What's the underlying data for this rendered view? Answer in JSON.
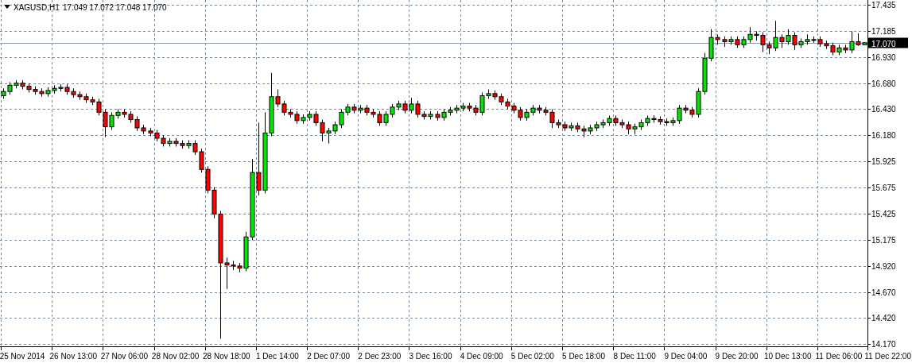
{
  "header": {
    "symbol": "XAGUSD,H1",
    "quote": "17.049 17.072 17.048 17.070"
  },
  "chart": {
    "axis_end_label": "11 Dec 22:00",
    "chart_data": {
      "type": "candlestick",
      "grid": true,
      "ylim": [
        14.17,
        17.435
      ],
      "yticks": [
        {
          "value": 17.435,
          "label": "17.435"
        },
        {
          "value": 17.185,
          "label": "17.185"
        },
        {
          "value": 16.93,
          "label": "16.930"
        },
        {
          "value": 16.68,
          "label": "16.680"
        },
        {
          "value": 16.43,
          "label": "16.430"
        },
        {
          "value": 16.18,
          "label": "16.180"
        },
        {
          "value": 15.925,
          "label": "15.925"
        },
        {
          "value": 15.675,
          "label": "15.675"
        },
        {
          "value": 15.425,
          "label": "15.425"
        },
        {
          "value": 15.175,
          "label": "15.175"
        },
        {
          "value": 14.92,
          "label": "14.920"
        },
        {
          "value": 14.67,
          "label": "14.670"
        },
        {
          "value": 14.42,
          "label": "14.420"
        },
        {
          "value": 14.17,
          "label": "14.170"
        }
      ],
      "ref_lines": [
        {
          "axis": "y",
          "value": 17.07,
          "label": "17.070"
        }
      ],
      "categories": [
        null,
        null,
        null,
        "25 Nov 2014",
        null,
        null,
        null,
        null,
        null,
        null,
        null,
        "26 Nov 13:00",
        null,
        null,
        null,
        null,
        null,
        null,
        null,
        "27 Nov 06:00",
        null,
        null,
        null,
        null,
        null,
        null,
        null,
        "28 Nov 02:00",
        null,
        null,
        null,
        null,
        null,
        null,
        null,
        "28 Nov 18:00",
        null,
        null,
        null,
        null,
        null,
        null,
        null,
        "1 Dec 14:00",
        null,
        null,
        null,
        null,
        null,
        null,
        null,
        "2 Dec 07:00",
        null,
        null,
        null,
        null,
        null,
        null,
        null,
        "2 Dec 23:00",
        null,
        null,
        null,
        null,
        null,
        null,
        null,
        "3 Dec 16:00",
        null,
        null,
        null,
        null,
        null,
        null,
        null,
        "4 Dec 09:00",
        null,
        null,
        null,
        null,
        null,
        null,
        null,
        "5 Dec 02:00",
        null,
        null,
        null,
        null,
        null,
        null,
        null,
        "5 Dec 18:00",
        null,
        null,
        null,
        null,
        null,
        null,
        null,
        "8 Dec 11:00",
        null,
        null,
        null,
        null,
        null,
        null,
        null,
        "9 Dec 04:00",
        null,
        null,
        null,
        null,
        null,
        null,
        null,
        "9 Dec 20:00",
        null,
        null,
        null,
        null,
        null,
        null,
        null,
        "10 Dec 13:00",
        null,
        null,
        null,
        null,
        null,
        null,
        null,
        "11 Dec 06:00",
        null,
        null,
        null,
        null
      ],
      "ohlc": [
        [
          16.56,
          16.63,
          16.53,
          16.6
        ],
        [
          16.6,
          16.69,
          16.57,
          16.66
        ],
        [
          16.66,
          16.71,
          16.63,
          16.68
        ],
        [
          16.68,
          16.71,
          16.62,
          16.65
        ],
        [
          16.65,
          16.68,
          16.59,
          16.62
        ],
        [
          16.62,
          16.65,
          16.57,
          16.6
        ],
        [
          16.6,
          16.63,
          16.55,
          16.58
        ],
        [
          16.58,
          16.64,
          16.55,
          16.61
        ],
        [
          16.61,
          16.66,
          16.58,
          16.63
        ],
        [
          16.63,
          16.67,
          16.6,
          16.64
        ],
        [
          16.64,
          16.67,
          16.57,
          16.6
        ],
        [
          16.6,
          16.63,
          16.54,
          16.57
        ],
        [
          16.57,
          16.6,
          16.52,
          16.55
        ],
        [
          16.55,
          16.58,
          16.49,
          16.52
        ],
        [
          16.52,
          16.55,
          16.47,
          16.5
        ],
        [
          16.5,
          16.53,
          16.37,
          16.4
        ],
        [
          16.4,
          16.43,
          16.16,
          16.26
        ],
        [
          16.26,
          16.4,
          16.23,
          16.37
        ],
        [
          16.37,
          16.43,
          16.34,
          16.4
        ],
        [
          16.4,
          16.43,
          16.35,
          16.38
        ],
        [
          16.38,
          16.41,
          16.3,
          16.33
        ],
        [
          16.33,
          16.36,
          16.22,
          16.25
        ],
        [
          16.25,
          16.28,
          16.19,
          16.22
        ],
        [
          16.22,
          16.25,
          16.17,
          16.2
        ],
        [
          16.2,
          16.23,
          16.12,
          16.15
        ],
        [
          16.15,
          16.18,
          16.07,
          16.1
        ],
        [
          16.1,
          16.15,
          16.07,
          16.12
        ],
        [
          16.12,
          16.15,
          16.07,
          16.1
        ],
        [
          16.1,
          16.13,
          16.05,
          16.08
        ],
        [
          16.08,
          16.13,
          16.05,
          16.1
        ],
        [
          16.1,
          16.13,
          15.99,
          16.02
        ],
        [
          16.02,
          16.05,
          15.82,
          15.85
        ],
        [
          15.85,
          15.88,
          15.62,
          15.65
        ],
        [
          15.65,
          15.68,
          15.38,
          15.42
        ],
        [
          15.42,
          15.45,
          14.22,
          14.95
        ],
        [
          14.95,
          15.0,
          14.7,
          14.93
        ],
        [
          14.93,
          14.97,
          14.88,
          14.92
        ],
        [
          14.92,
          14.95,
          14.86,
          14.9
        ],
        [
          14.9,
          15.25,
          14.87,
          15.2
        ],
        [
          15.2,
          15.95,
          15.17,
          15.82
        ],
        [
          15.82,
          16.3,
          15.6,
          15.65
        ],
        [
          15.65,
          16.4,
          15.62,
          16.2
        ],
        [
          16.2,
          16.78,
          16.17,
          16.55
        ],
        [
          16.55,
          16.62,
          16.45,
          16.48
        ],
        [
          16.48,
          16.51,
          16.37,
          16.4
        ],
        [
          16.4,
          16.43,
          16.35,
          16.38
        ],
        [
          16.38,
          16.41,
          16.29,
          16.32
        ],
        [
          16.32,
          16.38,
          16.29,
          16.35
        ],
        [
          16.35,
          16.41,
          16.32,
          16.38
        ],
        [
          16.38,
          16.41,
          16.27,
          16.3
        ],
        [
          16.3,
          16.33,
          16.12,
          16.2
        ],
        [
          16.2,
          16.25,
          16.1,
          16.22
        ],
        [
          16.22,
          16.31,
          16.19,
          16.28
        ],
        [
          16.28,
          16.43,
          16.25,
          16.4
        ],
        [
          16.4,
          16.48,
          16.37,
          16.45
        ],
        [
          16.45,
          16.48,
          16.39,
          16.42
        ],
        [
          16.42,
          16.47,
          16.39,
          16.44
        ],
        [
          16.44,
          16.47,
          16.37,
          16.4
        ],
        [
          16.4,
          16.43,
          16.35,
          16.38
        ],
        [
          16.38,
          16.41,
          16.27,
          16.3
        ],
        [
          16.3,
          16.41,
          16.27,
          16.38
        ],
        [
          16.38,
          16.48,
          16.35,
          16.45
        ],
        [
          16.45,
          16.51,
          16.42,
          16.48
        ],
        [
          16.48,
          16.51,
          16.39,
          16.42
        ],
        [
          16.42,
          16.54,
          16.39,
          16.48
        ],
        [
          16.48,
          16.51,
          16.35,
          16.38
        ],
        [
          16.38,
          16.41,
          16.33,
          16.36
        ],
        [
          16.36,
          16.41,
          16.33,
          16.38
        ],
        [
          16.38,
          16.41,
          16.32,
          16.35
        ],
        [
          16.35,
          16.43,
          16.32,
          16.4
        ],
        [
          16.4,
          16.45,
          16.37,
          16.42
        ],
        [
          16.42,
          16.47,
          16.39,
          16.44
        ],
        [
          16.44,
          16.49,
          16.41,
          16.46
        ],
        [
          16.46,
          16.49,
          16.41,
          16.44
        ],
        [
          16.44,
          16.47,
          16.37,
          16.4
        ],
        [
          16.4,
          16.59,
          16.37,
          16.56
        ],
        [
          16.56,
          16.62,
          16.53,
          16.58
        ],
        [
          16.58,
          16.61,
          16.52,
          16.55
        ],
        [
          16.55,
          16.58,
          16.47,
          16.5
        ],
        [
          16.5,
          16.53,
          16.43,
          16.46
        ],
        [
          16.46,
          16.49,
          16.39,
          16.42
        ],
        [
          16.42,
          16.45,
          16.32,
          16.35
        ],
        [
          16.35,
          16.43,
          16.32,
          16.4
        ],
        [
          16.4,
          16.47,
          16.37,
          16.44
        ],
        [
          16.44,
          16.47,
          16.39,
          16.42
        ],
        [
          16.42,
          16.45,
          16.37,
          16.4
        ],
        [
          16.4,
          16.43,
          16.25,
          16.3
        ],
        [
          16.3,
          16.33,
          16.25,
          16.28
        ],
        [
          16.28,
          16.31,
          16.22,
          16.25
        ],
        [
          16.25,
          16.3,
          16.22,
          16.27
        ],
        [
          16.27,
          16.3,
          16.21,
          16.24
        ],
        [
          16.24,
          16.27,
          16.16,
          16.22
        ],
        [
          16.22,
          16.28,
          16.19,
          16.25
        ],
        [
          16.25,
          16.31,
          16.22,
          16.28
        ],
        [
          16.28,
          16.33,
          16.25,
          16.3
        ],
        [
          16.3,
          16.37,
          16.27,
          16.34
        ],
        [
          16.34,
          16.37,
          16.27,
          16.3
        ],
        [
          16.3,
          16.33,
          16.25,
          16.28
        ],
        [
          16.28,
          16.31,
          16.19,
          16.24
        ],
        [
          16.24,
          16.29,
          16.19,
          16.26
        ],
        [
          16.26,
          16.33,
          16.23,
          16.3
        ],
        [
          16.3,
          16.37,
          16.27,
          16.34
        ],
        [
          16.34,
          16.37,
          16.3,
          16.33
        ],
        [
          16.33,
          16.36,
          16.28,
          16.31
        ],
        [
          16.31,
          16.34,
          16.27,
          16.3
        ],
        [
          16.3,
          16.35,
          16.27,
          16.32
        ],
        [
          16.32,
          16.47,
          16.29,
          16.44
        ],
        [
          16.44,
          16.47,
          16.39,
          16.42
        ],
        [
          16.42,
          16.45,
          16.35,
          16.38
        ],
        [
          16.38,
          16.63,
          16.35,
          16.6
        ],
        [
          16.6,
          16.97,
          16.57,
          16.92
        ],
        [
          16.92,
          17.2,
          16.89,
          17.12
        ],
        [
          17.12,
          17.15,
          17.05,
          17.1
        ],
        [
          17.1,
          17.13,
          17.03,
          17.08
        ],
        [
          17.08,
          17.13,
          17.05,
          17.1
        ],
        [
          17.1,
          17.13,
          17.02,
          17.05
        ],
        [
          17.05,
          17.13,
          17.02,
          17.1
        ],
        [
          17.1,
          17.22,
          17.07,
          17.15
        ],
        [
          17.15,
          17.18,
          17.09,
          17.14
        ],
        [
          17.14,
          17.17,
          16.98,
          17.05
        ],
        [
          17.05,
          17.08,
          16.96,
          17.02
        ],
        [
          17.02,
          17.28,
          16.99,
          17.12
        ],
        [
          17.12,
          17.15,
          17.02,
          17.08
        ],
        [
          17.08,
          17.2,
          17.05,
          17.14
        ],
        [
          17.14,
          17.17,
          17.0,
          17.05
        ],
        [
          17.05,
          17.11,
          17.02,
          17.08
        ],
        [
          17.08,
          17.15,
          17.05,
          17.1
        ],
        [
          17.1,
          17.13,
          17.07,
          17.1
        ],
        [
          17.1,
          17.13,
          17.03,
          17.06
        ],
        [
          17.06,
          17.09,
          17.01,
          17.04
        ],
        [
          17.04,
          17.07,
          16.95,
          16.98
        ],
        [
          16.98,
          17.05,
          16.95,
          17.02
        ],
        [
          17.02,
          17.05,
          16.97,
          17.0
        ],
        [
          17.0,
          17.18,
          16.97,
          17.08
        ],
        [
          17.08,
          17.16,
          17.04,
          17.05
        ],
        [
          17.049,
          17.072,
          17.048,
          17.07
        ]
      ]
    }
  }
}
